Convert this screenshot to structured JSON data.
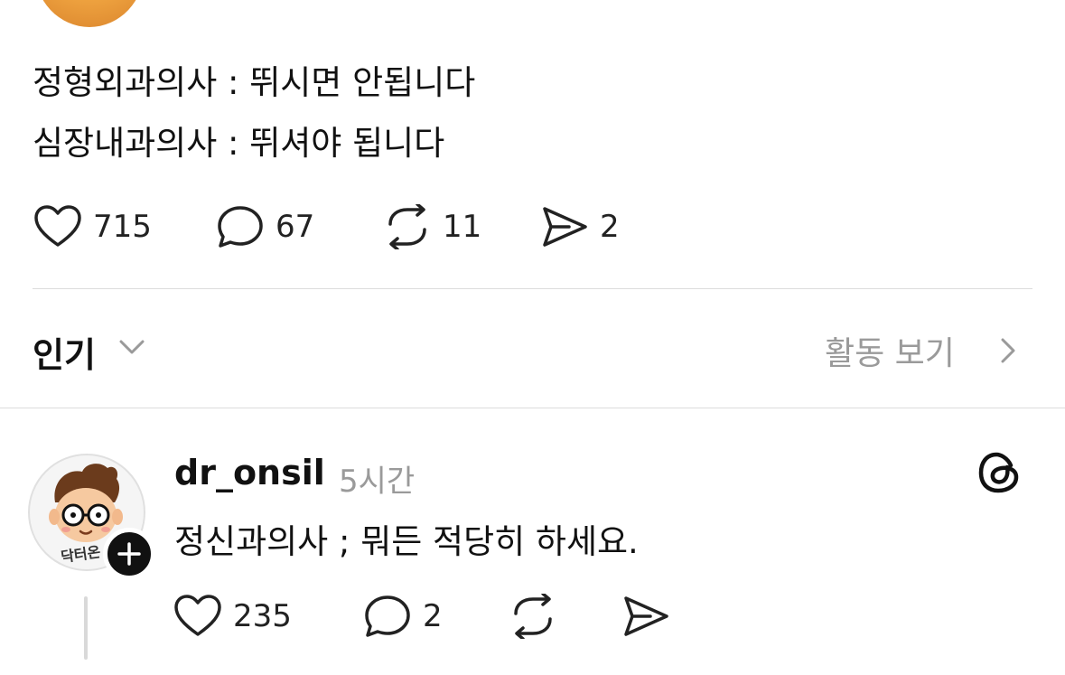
{
  "post": {
    "lines": [
      "정형외과의사 : 뛰시면 안됩니다",
      "심장내과의사 : 뛰셔야 됩니다"
    ],
    "stats": {
      "likes": "715",
      "replies": "67",
      "reposts": "11",
      "shares": "2"
    }
  },
  "replies_header": {
    "sort_label": "인기",
    "activity_label": "활동 보기"
  },
  "reply": {
    "username": "dr_onsil",
    "time": "5시간",
    "avatar_text": "닥터온",
    "text": "정신과의사 ; 뭐든 적당히 하세요.",
    "stats": {
      "likes": "235",
      "replies": "2"
    }
  },
  "icons": [
    "heart-icon",
    "comment-icon",
    "repost-icon",
    "send-icon",
    "chevron-down-icon",
    "chevron-right-icon",
    "plus-icon",
    "threads-logo-icon"
  ],
  "colors": {
    "text": "#111111",
    "muted": "#9a9a9a",
    "divider": "#dcdcdc",
    "badge": "#111111"
  }
}
